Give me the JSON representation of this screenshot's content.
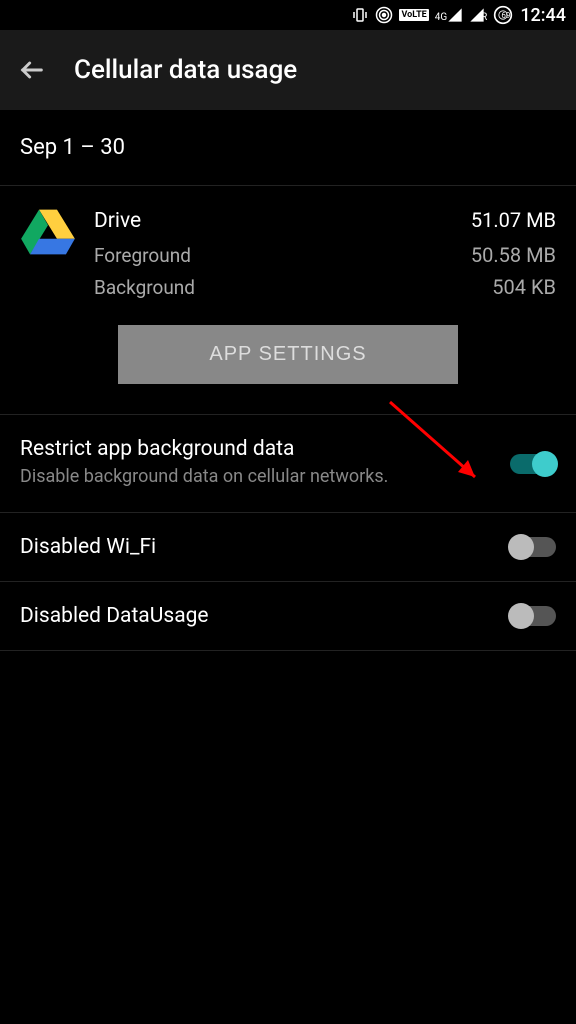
{
  "status_bar": {
    "volte": "VoLTE",
    "net_label": "4G",
    "roaming": "R",
    "battery": "69",
    "clock": "12:44"
  },
  "header": {
    "title": "Cellular data usage"
  },
  "date_range": "Sep 1 – 30",
  "app": {
    "name": "Drive",
    "total": "51.07 MB",
    "foreground_label": "Foreground",
    "foreground_value": "50.58 MB",
    "background_label": "Background",
    "background_value": "504 KB"
  },
  "app_settings_button": "APP SETTINGS",
  "toggles": [
    {
      "title": "Restrict app background data",
      "subtitle": "Disable background data on cellular networks.",
      "on": true
    },
    {
      "title": "Disabled Wi_Fi",
      "subtitle": "",
      "on": false
    },
    {
      "title": "Disabled DataUsage",
      "subtitle": "",
      "on": false
    }
  ]
}
